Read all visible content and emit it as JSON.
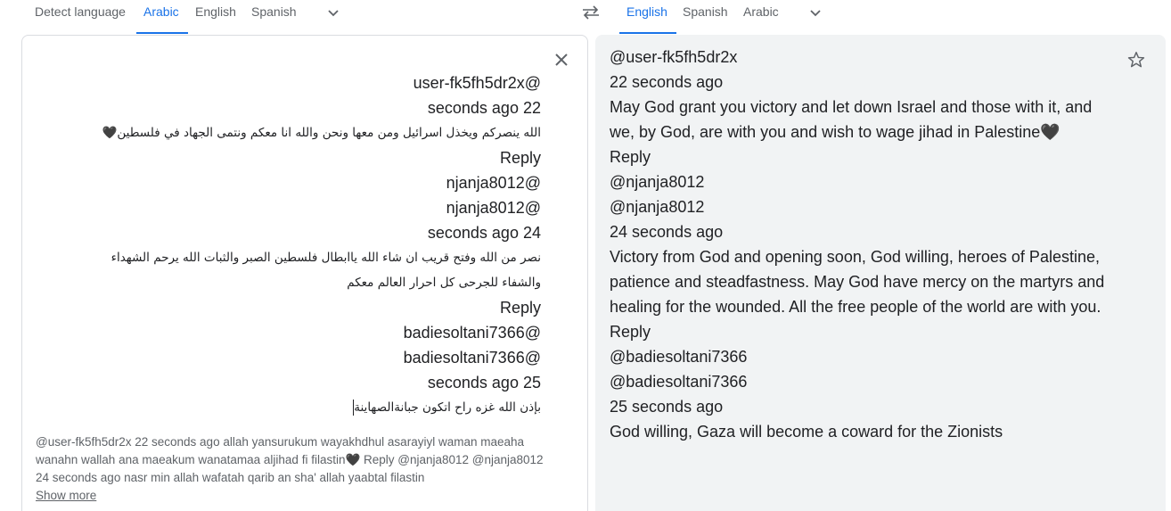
{
  "source_languages": {
    "tabs": [
      {
        "label": "Detect language"
      },
      {
        "label": "Arabic",
        "active": true
      },
      {
        "label": "English"
      },
      {
        "label": "Spanish"
      }
    ]
  },
  "target_languages": {
    "tabs": [
      {
        "label": "English",
        "active": true
      },
      {
        "label": "Spanish"
      },
      {
        "label": "Arabic"
      }
    ]
  },
  "icons": {
    "swap": "swap-arrows-icon",
    "chevron": "chevron-down-icon",
    "close": "close-icon",
    "star": "star-outline-icon"
  },
  "colors": {
    "accent": "#1a73e8",
    "muted_text": "#5f6368",
    "target_background": "#f1f3f4",
    "border": "#dadce0"
  },
  "source": {
    "lines": [
      "@user-fk5fh5dr2x",
      "22 seconds ago",
      "الله ينصركم ويخذل اسرائيل ومن معها ونحن والله انا معكم ونتمى الجهاد في فلسطين🖤",
      "Reply",
      "@njanja8012",
      "@njanja8012",
      "24 seconds ago",
      "نصر من الله وفتح قريب ان شاء الله ياابطال فلسطين الصبر والثبات الله يرحم الشهداء والشفاء للجرحى كل احرار العالم معكم",
      "Reply",
      "@badiesoltani7366",
      "@badiesoltani7366",
      "25 seconds ago",
      "بإذن  الله غزه راح اتكون جبانةالصهاينة"
    ],
    "transliteration": "@user-fk5fh5dr2x 22 seconds ago allah yansurukum wayakhdhul asarayiyl waman maeaha wanahn wallah ana maeakum wanatamaa aljihad fi filastin🖤 Reply @njanja8012 @njanja8012 24 seconds ago nasr min allah wafatah qarib an sha' allah yaabtal filastin",
    "show_more": "Show more"
  },
  "target": {
    "lines": [
      "@user-fk5fh5dr2x",
      "22 seconds ago",
      "May God grant you victory and let down Israel and those with it, and we, by God, are with you and wish to wage jihad in Palestine🖤",
      "Reply",
      "@njanja8012",
      "@njanja8012",
      "24 seconds ago",
      "Victory from God and opening soon, God willing, heroes of Palestine, patience and steadfastness. May God have mercy on the martyrs and healing for the wounded. All the free people of the world are with you.",
      "Reply",
      "@badiesoltani7366",
      "@badiesoltani7366",
      "25 seconds ago",
      "God willing, Gaza will become a coward for the Zionists"
    ]
  }
}
